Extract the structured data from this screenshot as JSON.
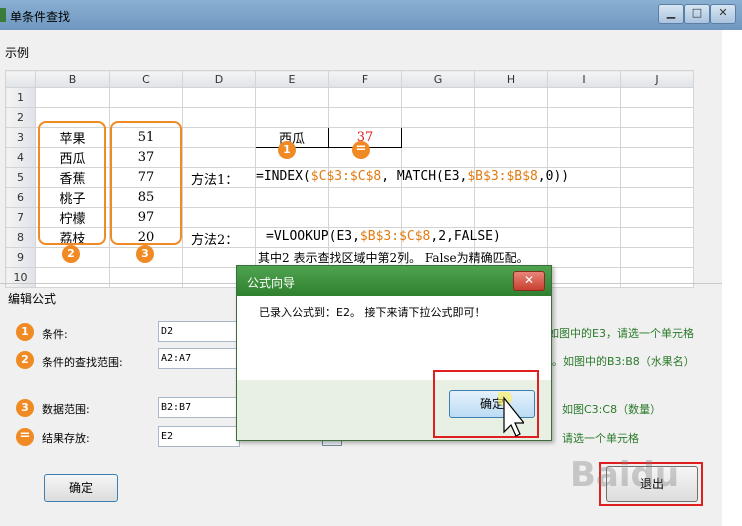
{
  "window": {
    "title": "单条件查找",
    "min": "▁",
    "max": "□",
    "close": "✕"
  },
  "example_label": "示例",
  "columns": [
    "B",
    "C",
    "D",
    "E",
    "F",
    "G",
    "H",
    "I",
    "J"
  ],
  "rows": [
    "1",
    "2",
    "3",
    "4",
    "5",
    "6",
    "7",
    "8",
    "9",
    "10"
  ],
  "fruits": [
    "苹果",
    "西瓜",
    "香蕉",
    "桃子",
    "柠檬",
    "荔枝"
  ],
  "numbers": [
    "51",
    "37",
    "77",
    "85",
    "97",
    "20"
  ],
  "e3": "西瓜",
  "f3": "37",
  "badges": {
    "one": "1",
    "two": "2",
    "three": "3",
    "eq": "="
  },
  "method1": {
    "label": "方法1：",
    "prefix": "=INDEX(",
    "range1": "$C$3:$C$8",
    "mid": ", MATCH(E3,",
    "range2": "$B$3:$B$8",
    "suffix": ",0))"
  },
  "method2": {
    "label": "方法2：",
    "prefix": "=VLOOKUP(E3,",
    "range": "$B$3:$C$8",
    "suffix": ",2,FALSE)"
  },
  "note": "其中2 表示查找区域中第2列。 False为精确匹配。",
  "edit": {
    "title": "编辑公式",
    "condition_label": "条件:",
    "condition_value": "D2",
    "range_label": "条件的查找范围:",
    "range_value": "A2:A7",
    "data_label": "数据范围:",
    "data_value": "B2:B7",
    "result_label": "结果存放:",
    "result_value": "E2",
    "hint1": "如图中的E3，请选一个单元格",
    "hint2": "。如图中的B3:B8（水果名）",
    "hint3": "如图C3:C8（数量）",
    "hint4": "请选一个单元格",
    "ok": "确定",
    "exit": "退出"
  },
  "dialog": {
    "title": "公式向导",
    "close": "✕",
    "message": "已录入公式到：E2。 接下来请下拉公式即可！",
    "ok": "确定"
  },
  "watermark": "Baidu"
}
